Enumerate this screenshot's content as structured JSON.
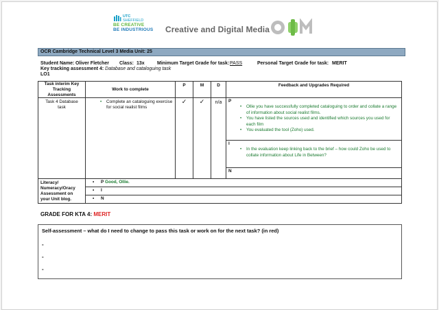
{
  "header": {
    "utc_top": "UTC",
    "utc_city": "SHEFFIELD",
    "utc_line1": "BE CREATIVE",
    "utc_line2": "BE INDUSTRIOUS",
    "title": "Creative and Digital Media",
    "cdm": "CDM"
  },
  "course_bar": "OCR Cambridge Technical Level 3 Media   Unit: 25",
  "student": {
    "name_label": "Student Name:",
    "name": "Oliver Fletcher",
    "class_label": "Class:",
    "class": "13x",
    "min_label": "Minimum Target Grade for task:",
    "min": "PASS",
    "personal_label": "Personal Target  Grade for task:",
    "personal": "MERIT"
  },
  "kta_label": "Key tracking assessment 4:",
  "kta_title": "Database and cataloguing task",
  "lo": "LO1",
  "table": {
    "headers": [
      "Task interim Key Tracking Assessments",
      "Work to complete",
      "P",
      "M",
      "D",
      "Feedback and Upgrades Required"
    ],
    "task": "Task 4 Database task",
    "work": "Complete an cataloguing exercise for social realist films",
    "p": "✓",
    "m": "✓",
    "d": "n/a",
    "fb_p_label": "P",
    "fb_p": [
      "Ollie you have successfully completed cataloguing to order and collate a range of information about social realist films.",
      "You have listed the sources used and identified which sources you used for each film",
      "You evaluated the tool (Zoho) used."
    ],
    "fb_m_label": "I",
    "fb_m": [
      "In the evaluation keep linking back to the brief – how could Zoho be used to collate information about Life in Between?"
    ],
    "fb_n_label": "N",
    "lit_label": "Literacy/ Numeracy/Oracy Assessment on your Unit blog.",
    "lit_p_label": "P",
    "lit_p": "Good, Ollie.",
    "lit_i": "I",
    "lit_n": "N"
  },
  "grade_label": "GRADE FOR KTA 4:",
  "grade": "MERIT",
  "self": {
    "question": "Self-assessment – what do I need to change to pass this task or work on for the next task? (in red)",
    "bullets": [
      "-",
      "-",
      "-"
    ]
  }
}
